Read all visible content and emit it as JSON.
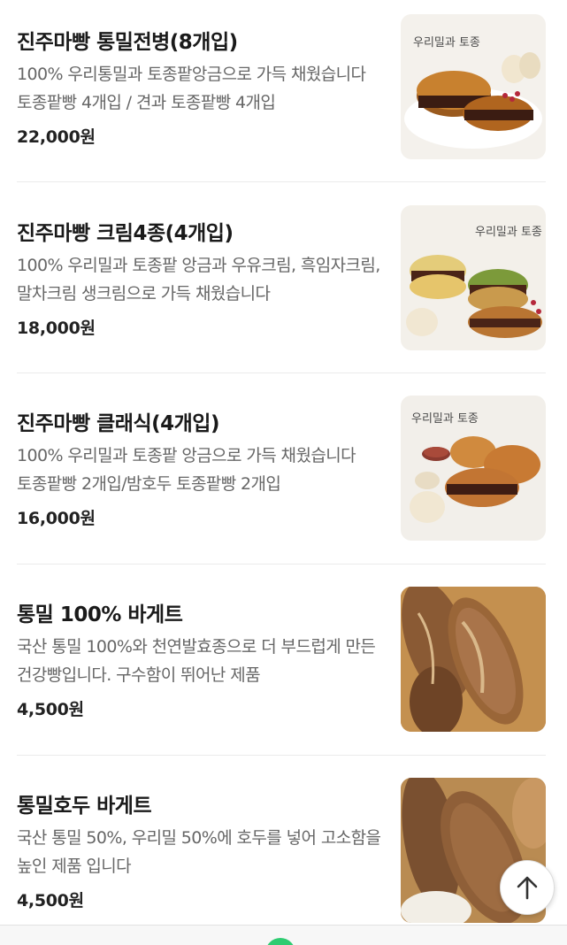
{
  "products": [
    {
      "name": "진주마빵 통밀전병(8개입)",
      "description": "100% 우리통밀과 토종팥앙금으로 가득 채웠습니다 토종팥빵 4개입 / 견과 토종팥빵 4개입",
      "price": "22,000원",
      "image_logo": "우리밀과 토종",
      "image": "bun-photo"
    },
    {
      "name": "진주마빵 크림4종(4개입)",
      "description": "100% 우리밀과 토종팥 앙금과 우유크림, 흑임자크림, 말차크림 생크림으로 가득 채웠습니다",
      "price": "18,000원",
      "image_logo": "우리밀과 토종",
      "image": "bun-photo"
    },
    {
      "name": "진주마빵 클래식(4개입)",
      "description": "100% 우리밀과 토종팥 앙금으로 가득 채웠습니다 토종팥빵 2개입/밤호두 토종팥빵 2개입",
      "price": "16,000원",
      "image_logo": "우리밀과 토종",
      "image": "bun-photo"
    },
    {
      "name": "통밀 100% 바게트",
      "description": "국산 통밀 100%와 천연발효종으로 더 부드럽게 만든 건강빵입니다. 구수함이 뛰어난 제품",
      "price": "4,500원",
      "image": "baguette-photo"
    },
    {
      "name": "통밀호두 바게트",
      "description": "국산 통밀 50%, 우리밀 50%에 호두를 넣어 고소함을 높인 제품 입니다",
      "price": "4,500원",
      "image": "baguette-photo"
    }
  ],
  "scroll_top_button": {
    "icon": "arrow-up-icon"
  },
  "colors": {
    "title": "#1a1a1a",
    "description": "#666666",
    "price": "#222222",
    "divider": "#ebebeb",
    "bottom_indicator": "#2ecc71"
  }
}
